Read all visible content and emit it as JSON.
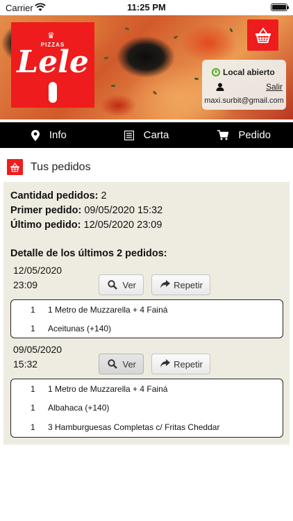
{
  "status_bar": {
    "carrier": "Carrier",
    "time": "11:25 PM"
  },
  "hero": {
    "logo": {
      "top_text": "PIZZAS",
      "main_text": "Lele"
    },
    "status_card": {
      "status": "Local abierto",
      "logout": "Salir",
      "email": "maxi.surbit@gmail.com"
    }
  },
  "nav": {
    "info": "Info",
    "carta": "Carta",
    "pedido": "Pedido"
  },
  "section": {
    "title": "Tus pedidos"
  },
  "summary": {
    "count_label": "Cantidad pedidos:",
    "count_value": "2",
    "first_label": "Primer pedido:",
    "first_value": "09/05/2020 15:32",
    "last_label": "Último pedido:",
    "last_value": "12/05/2020 23:09",
    "detail_title": "Detalle de los últimos 2 pedidos:"
  },
  "orders": [
    {
      "date": "12/05/2020",
      "time": "23:09",
      "view_label": "Ver",
      "repeat_label": "Repetir",
      "items": [
        {
          "qty": "1",
          "name": "1 Metro de Muzzarella + 4 Fainá"
        },
        {
          "qty": "1",
          "name": "Aceitunas (+140)"
        }
      ]
    },
    {
      "date": "09/05/2020",
      "time": "15:32",
      "view_label": "Ver",
      "repeat_label": "Repetir",
      "items": [
        {
          "qty": "1",
          "name": "1 Metro de Muzzarella + 4 Fainá"
        },
        {
          "qty": "1",
          "name": "Albahaca (+140)"
        },
        {
          "qty": "1",
          "name": "3 Hamburguesas Completas c/ Fritas Cheddar"
        }
      ]
    }
  ],
  "colors": {
    "brand_red": "#ee1c1c",
    "nav_bg": "#000000",
    "panel_bg": "#eeebe1",
    "open_green": "#4caf1f"
  }
}
